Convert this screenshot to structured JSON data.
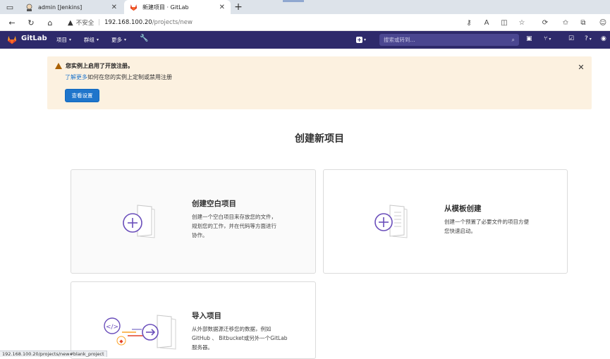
{
  "browser": {
    "tabs": [
      {
        "title": "admin [Jenkins]",
        "active": false
      },
      {
        "title": "新建项目 · GitLab",
        "active": true
      }
    ],
    "security_label": "不安全",
    "url_host": "192.168.100.20",
    "url_path": "/projects/new",
    "status_url": "192.168.100.20/projects/new#blank_project"
  },
  "gitlab_nav": {
    "brand": "GitLab",
    "menu_projects": "项目",
    "menu_groups": "群组",
    "menu_more": "更多",
    "search_placeholder": "搜索或转到..."
  },
  "banner": {
    "title": "您实例上启用了开放注册。",
    "link_text": "了解更多",
    "text_rest": "如何在您的实例上定制或禁用注册",
    "button_label": "查看设置"
  },
  "page": {
    "title": "创建新项目"
  },
  "cards": {
    "blank": {
      "title": "创建空白项目",
      "desc": "创建一个空白项目来存放您的文件，\n规划您的工作，并在代码等方面进行\n协作。"
    },
    "template": {
      "title": "从模板创建",
      "desc": "创建一个预置了必要文件的项目方便\n您快速启动。"
    },
    "import": {
      "title": "导入项目",
      "desc": "从外部数据源迁移您的数据，例如\nGitHub 、 Bitbucket或另外一个GitLab\n服务器。"
    }
  },
  "colors": {
    "nav_bg": "#2e2a6b",
    "accent_purple": "#6b4fbb",
    "banner_bg": "#fcf1e0",
    "button_blue": "#1f75cb"
  }
}
